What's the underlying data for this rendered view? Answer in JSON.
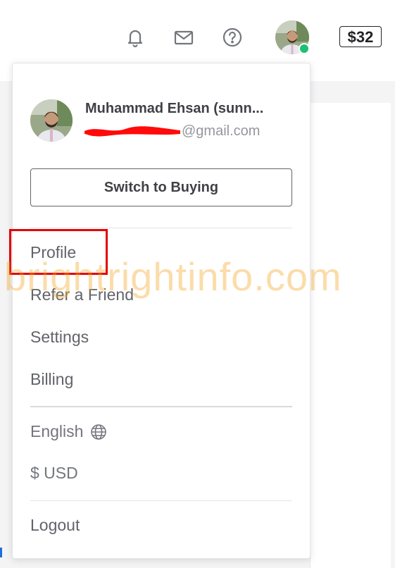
{
  "header": {
    "icons": [
      "bell-icon",
      "envelope-icon",
      "help-icon"
    ],
    "balance": "$32",
    "online_status_color": "#1dbf73"
  },
  "user_menu": {
    "name": "Muhammad Ehsan (sunn...",
    "email_suffix": "@gmail.com",
    "switch_button": "Switch to Buying",
    "items": [
      {
        "label": "Profile"
      },
      {
        "label": "Refer a Friend"
      },
      {
        "label": "Settings"
      },
      {
        "label": "Billing"
      }
    ],
    "language": "English",
    "currency": "$ USD",
    "logout": "Logout"
  },
  "annotation": {
    "highlight_color": "#e30000",
    "watermark": "brightrightinfo.com"
  }
}
